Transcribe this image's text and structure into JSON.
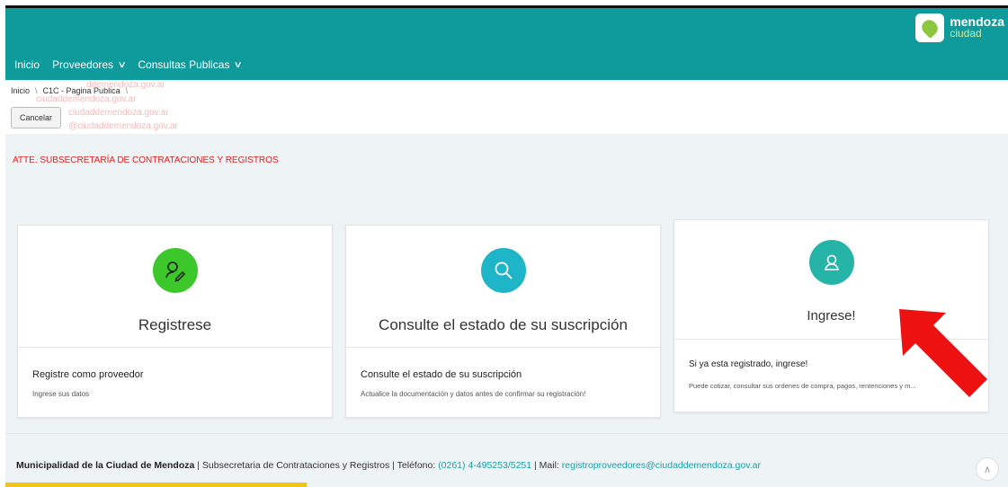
{
  "header": {
    "logo_line1": "mendoza",
    "logo_line2": "ciudad",
    "nav": [
      {
        "label": "Inicio",
        "has_dropdown": false
      },
      {
        "label": "Proveedores",
        "has_dropdown": true
      },
      {
        "label": "Consultas Publicas",
        "has_dropdown": true
      }
    ],
    "color": "#0f9a9c"
  },
  "breadcrumb": {
    "items": [
      "Inicio",
      "C1C - Pagina Publica"
    ]
  },
  "ghost_text": [
    "ddemendoza.gov.ar",
    "ciudaddemendoza.gov.ar",
    "ciudaddemendoza.gov.ar",
    "@ciudaddemendoza.gov.ar"
  ],
  "cancel_label": "Cancelar",
  "notice": "ATTE. SUBSECRETARÍA DE CONTRATACIONES Y REGISTROS",
  "cards": [
    {
      "title": "Registrese",
      "line1": "Registre como proveedor",
      "line2": "Ingrese sus datos",
      "icon": "user-edit-icon",
      "color": "#3cc72a"
    },
    {
      "title": "Consulte el estado de su suscripción",
      "line1": "Consulte el estado de su suscripción",
      "line2": "Actualice la documentación y datos antes de confirmar su registración!",
      "icon": "search-icon",
      "color": "#1fb5c8"
    },
    {
      "title": "Ingrese!",
      "line1": "Si ya esta registrado, ingrese!",
      "line2": "Puede cotizar, consultar sus ordenes de compra, pagos, rentenciones y m...",
      "icon": "user-icon",
      "color": "#26b4a8"
    }
  ],
  "footer": {
    "org": "Municipalidad de la Ciudad de Mendoza",
    "dept": " | Subsecretaria de Contrataciones y Registros | Teléfono: ",
    "phone": "(0261) 4-495253/5251",
    "mail_label": " | Mail: ",
    "mail": "registroproveedores@ciudaddemendoza.gov.ar"
  },
  "annotation_arrow_color": "#ee1111"
}
